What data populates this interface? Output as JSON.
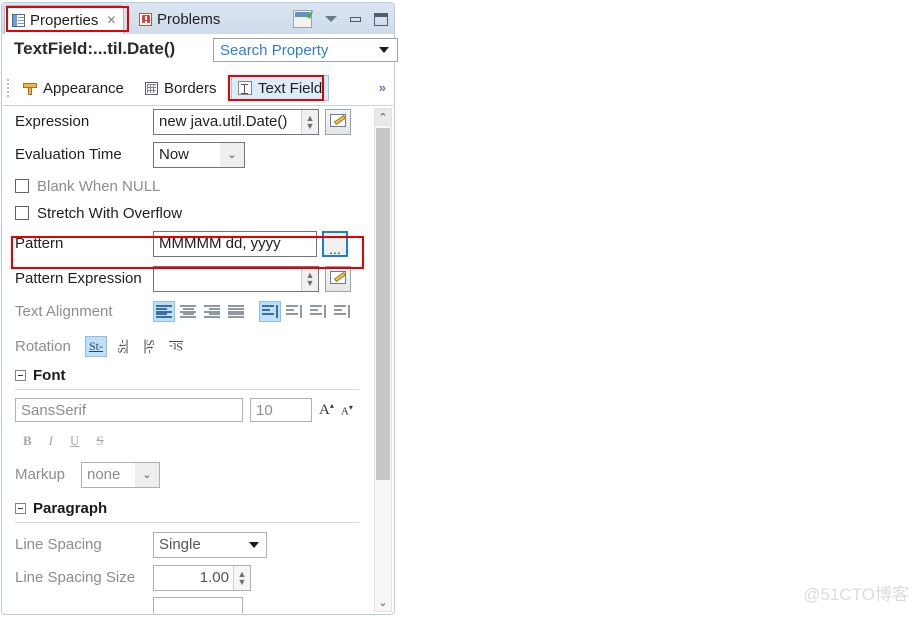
{
  "window": {
    "tabs": [
      {
        "label": "Properties",
        "icon": "properties-icon",
        "active": true,
        "close": "✕"
      },
      {
        "label": "Problems",
        "icon": "problems-icon",
        "active": false
      }
    ],
    "toolbar": {
      "pin": "pin-view-icon",
      "menu": "view-menu-icon",
      "minimize": "minimize-icon",
      "maximize": "maximize-icon"
    }
  },
  "header": {
    "object_title": "TextField:...til.Date()",
    "search": {
      "placeholder": "Search Property",
      "value": "Search Property"
    }
  },
  "section_tabs": {
    "items": [
      {
        "label": "Appearance",
        "icon": "ruler-icon",
        "active": false
      },
      {
        "label": "Borders",
        "icon": "grid-icon",
        "active": false
      },
      {
        "label": "Text Field",
        "icon": "text-ibeam-icon",
        "active": true
      }
    ],
    "overflow": "»"
  },
  "form": {
    "expression": {
      "label": "Expression",
      "value": "new java.util.Date()"
    },
    "evaluation_time": {
      "label": "Evaluation Time",
      "value": "Now",
      "options": [
        "Now"
      ]
    },
    "blank_when_null": {
      "label": "Blank When NULL",
      "checked": false,
      "enabled": false
    },
    "stretch_with_overflow": {
      "label": "Stretch With Overflow",
      "checked": false,
      "enabled": true
    },
    "pattern": {
      "label": "Pattern",
      "value": "MMMMM dd, yyyy",
      "browse_label": "..."
    },
    "pattern_expression": {
      "label": "Pattern Expression",
      "value": ""
    },
    "text_alignment": {
      "label": "Text Alignment",
      "horizontal": [
        {
          "name": "align-left",
          "selected": true
        },
        {
          "name": "align-center",
          "selected": false
        },
        {
          "name": "align-right",
          "selected": false
        },
        {
          "name": "align-justify",
          "selected": false
        }
      ],
      "vertical": [
        {
          "name": "valign-top",
          "selected": true
        },
        {
          "name": "valign-middle",
          "selected": false
        },
        {
          "name": "valign-bottom",
          "selected": false
        },
        {
          "name": "valign-justify",
          "selected": false
        }
      ]
    },
    "rotation": {
      "label": "Rotation",
      "options": [
        {
          "name": "rotation-none",
          "text": "St-",
          "selected": true
        },
        {
          "name": "rotation-left",
          "text": "St-",
          "selected": false
        },
        {
          "name": "rotation-right",
          "text": "St-",
          "selected": false
        },
        {
          "name": "rotation-upside-down",
          "text": "St-",
          "selected": false
        }
      ]
    },
    "font_group": {
      "title": "Font",
      "family": {
        "value": "SansSerif"
      },
      "size": {
        "value": "10"
      },
      "increase_label": "A",
      "decrease_label": "A",
      "styles": [
        {
          "name": "bold",
          "label": "B"
        },
        {
          "name": "italic",
          "label": "I"
        },
        {
          "name": "underline",
          "label": "U"
        },
        {
          "name": "strikethrough",
          "label": "S"
        }
      ],
      "markup": {
        "label": "Markup",
        "value": "none",
        "options": [
          "none"
        ]
      }
    },
    "paragraph_group": {
      "title": "Paragraph",
      "line_spacing": {
        "label": "Line Spacing",
        "value": "Single",
        "options": [
          "Single"
        ]
      },
      "line_spacing_size": {
        "label": "Line Spacing Size",
        "value": "1.00"
      }
    }
  },
  "scrollbar": {
    "up": "⌃",
    "down": "⌄"
  },
  "watermark": "@51CTO博客"
}
